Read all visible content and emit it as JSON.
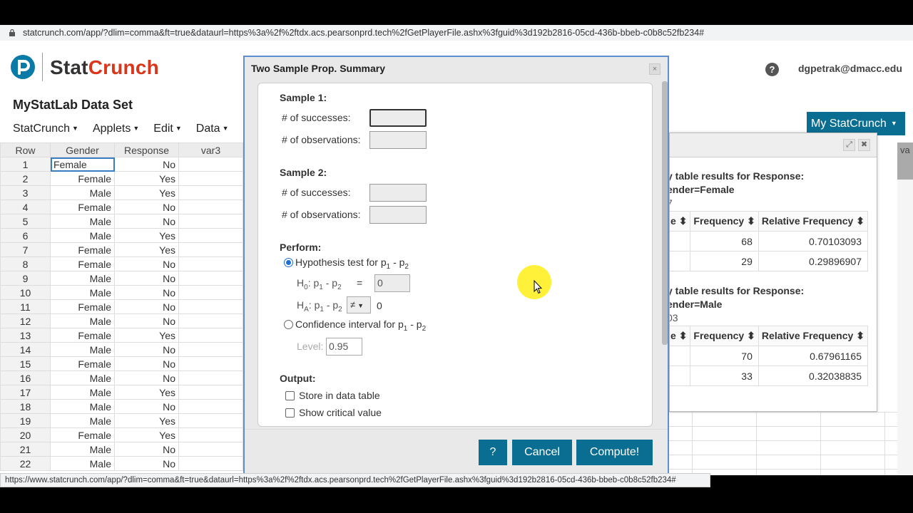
{
  "browser": {
    "url": "statcrunch.com/app/?dlim=comma&ft=true&dataurl=https%3a%2f%2ftdx.acs.pearsonprd.tech%2fGetPlayerFile.ashx%3fguid%3d192b2816-05cd-436b-bbeb-c0b8c52fb234#",
    "status_url": "https://www.statcrunch.com/app/?dlim=comma&ft=true&dataurl=https%3a%2f%2ftdx.acs.pearsonprd.tech%2fGetPlayerFile.ashx%3fguid%3d192b2816-05cd-436b-bbeb-c0b8c52fb234#"
  },
  "header": {
    "logo_stat": "Stat",
    "logo_crunch": "Crunch",
    "logo_letter": "P",
    "help": "?",
    "user": "dgpetrak@dmacc.edu"
  },
  "dataset": {
    "title": "MyStatLab Data Set",
    "menu": [
      {
        "label": "StatCrunch"
      },
      {
        "label": "Applets"
      },
      {
        "label": "Edit"
      },
      {
        "label": "Data"
      }
    ],
    "my_statcrunch": "My StatCrunch"
  },
  "grid": {
    "columns": [
      "Row",
      "Gender",
      "Response",
      "var3"
    ],
    "rows": [
      {
        "n": "1",
        "gender": "Female",
        "response": "No"
      },
      {
        "n": "2",
        "gender": "Female",
        "response": "Yes"
      },
      {
        "n": "3",
        "gender": "Male",
        "response": "Yes"
      },
      {
        "n": "4",
        "gender": "Female",
        "response": "No"
      },
      {
        "n": "5",
        "gender": "Male",
        "response": "No"
      },
      {
        "n": "6",
        "gender": "Male",
        "response": "Yes"
      },
      {
        "n": "7",
        "gender": "Female",
        "response": "Yes"
      },
      {
        "n": "8",
        "gender": "Female",
        "response": "No"
      },
      {
        "n": "9",
        "gender": "Male",
        "response": "No"
      },
      {
        "n": "10",
        "gender": "Male",
        "response": "No"
      },
      {
        "n": "11",
        "gender": "Female",
        "response": "No"
      },
      {
        "n": "12",
        "gender": "Male",
        "response": "No"
      },
      {
        "n": "13",
        "gender": "Female",
        "response": "Yes"
      },
      {
        "n": "14",
        "gender": "Male",
        "response": "No"
      },
      {
        "n": "15",
        "gender": "Female",
        "response": "No"
      },
      {
        "n": "16",
        "gender": "Male",
        "response": "No"
      },
      {
        "n": "17",
        "gender": "Male",
        "response": "Yes"
      },
      {
        "n": "18",
        "gender": "Male",
        "response": "No"
      },
      {
        "n": "19",
        "gender": "Male",
        "response": "Yes"
      },
      {
        "n": "20",
        "gender": "Female",
        "response": "Yes"
      },
      {
        "n": "21",
        "gender": "Male",
        "response": "No"
      },
      {
        "n": "22",
        "gender": "Male",
        "response": "No"
      }
    ],
    "right_col_partial": "va"
  },
  "results": {
    "caption1_line1": "y table results for Response:",
    "caption1_line2": "ender=Female",
    "caption1_line3": "7",
    "caption2_line1": "y table results for Response:",
    "caption2_line2": "ender=Male",
    "caption2_line3": "03",
    "col_partial": "e",
    "col_freq": "Frequency",
    "col_rel": "Relative Frequency",
    "sort_glyph": "⬍",
    "female": [
      {
        "freq": "68",
        "rel": "0.70103093"
      },
      {
        "freq": "29",
        "rel": "0.29896907"
      }
    ],
    "male": [
      {
        "freq": "70",
        "rel": "0.67961165"
      },
      {
        "freq": "33",
        "rel": "0.32038835"
      }
    ]
  },
  "dialog": {
    "title": "Two Sample Prop. Summary",
    "close": "×",
    "sample1_label": "Sample 1:",
    "sample2_label": "Sample 2:",
    "successes_label": "# of successes:",
    "observations_label": "# of observations:",
    "perform_label": "Perform:",
    "hyp_test": "Hypothesis test for p",
    "sub1": "1",
    "sub2": "2",
    "minus_p": " - p",
    "h0_prefix": "H",
    "h0_sub": "0",
    "ha_sub": "A",
    "colon_p": ": p",
    "eq": "=",
    "h0_value": "0",
    "neq_option": "≠",
    "ha_value": "0",
    "ci_label": "Confidence interval for p",
    "level_label": "Level:",
    "level_value": "0.95",
    "output_label": "Output:",
    "store_label": "Store in data table",
    "critical_label": "Show critical value",
    "help_btn": "?",
    "cancel_btn": "Cancel",
    "compute_btn": "Compute!"
  },
  "colors": {
    "brand_teal": "#0a6e92",
    "brand_red": "#d9361b",
    "cursor_highlight": "#fff023"
  }
}
